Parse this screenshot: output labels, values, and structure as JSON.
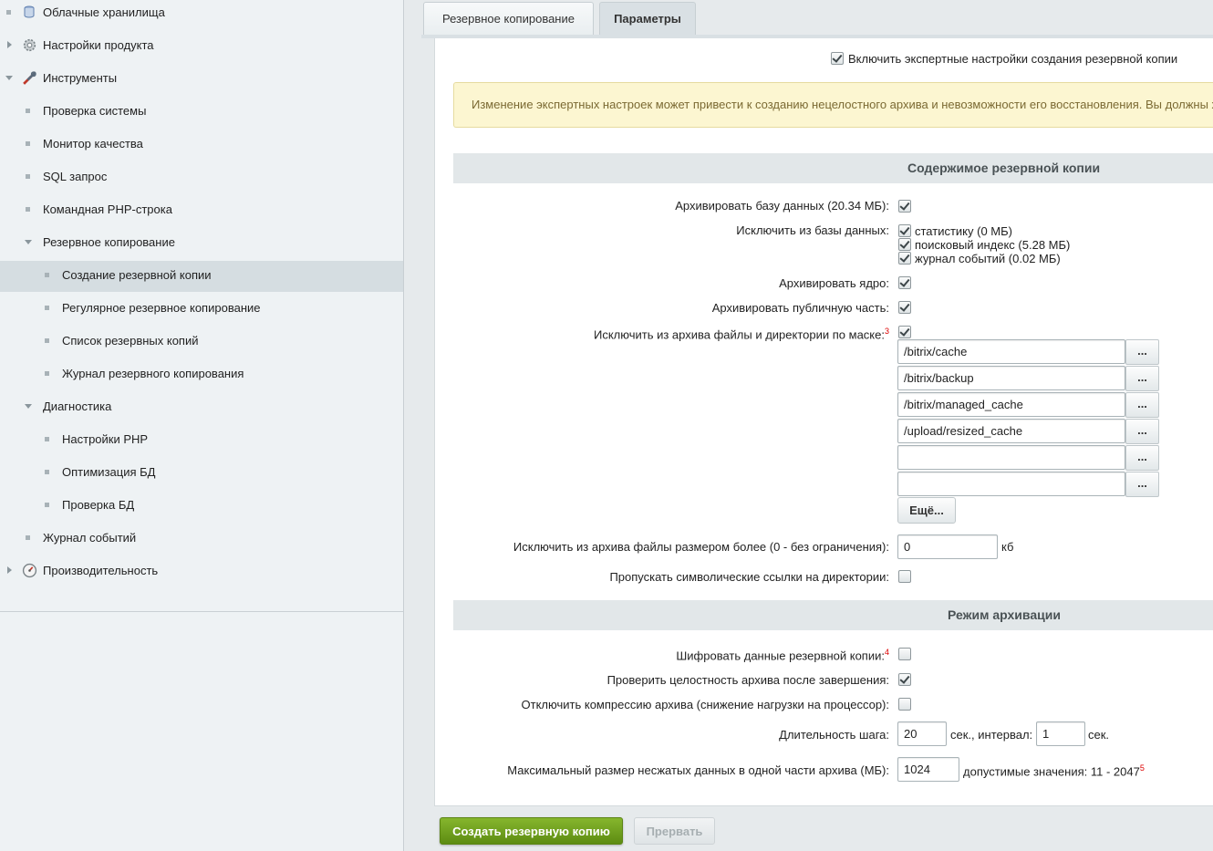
{
  "sidebar": {
    "items": [
      {
        "label": "Облачные хранилища"
      },
      {
        "label": "Настройки продукта"
      },
      {
        "label": "Инструменты"
      },
      {
        "label": "Проверка системы"
      },
      {
        "label": "Монитор качества"
      },
      {
        "label": "SQL запрос"
      },
      {
        "label": "Командная PHP-строка"
      },
      {
        "label": "Резервное копирование"
      },
      {
        "label": "Создание резервной копии"
      },
      {
        "label": "Регулярное резервное копирование"
      },
      {
        "label": "Список резервных копий"
      },
      {
        "label": "Журнал резервного копирования"
      },
      {
        "label": "Диагностика"
      },
      {
        "label": "Настройки PHP"
      },
      {
        "label": "Оптимизация БД"
      },
      {
        "label": "Проверка БД"
      },
      {
        "label": "Журнал событий"
      },
      {
        "label": "Производительность"
      }
    ]
  },
  "tabs": [
    {
      "label": "Резервное копирование"
    },
    {
      "label": "Параметры"
    }
  ],
  "expert": {
    "label": "Включить экспертные настройки создания резервной копии",
    "checked": true
  },
  "warning": "Изменение экспертных настроек может привести к созданию нецелостного архива и невозможности его восстановления. Вы должны хорошо понимать, что делаете.",
  "content_section": {
    "title": "Содержимое резервной копии",
    "archive_db": {
      "label": "Архивировать базу данных (20.34 МБ):",
      "checked": true
    },
    "exclude_db": {
      "label": "Исключить из базы данных:",
      "options": [
        {
          "label": "статистику (0 МБ)",
          "checked": true
        },
        {
          "label": "поисковый индекс (5.28 МБ)",
          "checked": true
        },
        {
          "label": "журнал событий (0.02 МБ)",
          "checked": true
        }
      ]
    },
    "archive_core": {
      "label": "Архивировать ядро:",
      "checked": true
    },
    "archive_public": {
      "label": "Архивировать публичную часть:",
      "checked": true
    },
    "exclude_mask": {
      "label": "Исключить из архива файлы и директории по маске:",
      "sup": "3",
      "checked": true,
      "masks": [
        "/bitrix/cache",
        "/bitrix/backup",
        "/bitrix/managed_cache",
        "/upload/resized_cache",
        "",
        ""
      ],
      "dots_label": "...",
      "more_label": "Ещё..."
    },
    "exclude_size": {
      "label": "Исключить из архива файлы размером более (0 - без ограничения):",
      "value": "0",
      "unit": "кб"
    },
    "skip_symlinks": {
      "label": "Пропускать символические ссылки на директории:",
      "checked": false
    }
  },
  "mode_section": {
    "title": "Режим архивации",
    "encrypt": {
      "label": "Шифровать данные резервной копии:",
      "sup": "4",
      "checked": false
    },
    "verify": {
      "label": "Проверить целостность архива после завершения:",
      "checked": true
    },
    "no_compress": {
      "label": "Отключить компрессию архива (снижение нагрузки на процессор):",
      "checked": false
    },
    "step": {
      "label": "Длительность шага:",
      "value": "20",
      "unit1": "сек., интервал:",
      "interval": "1",
      "unit2": "сек."
    },
    "max_size": {
      "label": "Максимальный размер несжатых данных в одной части архива (МБ):",
      "value": "1024",
      "hint": "допустимые значения: 11 - 2047",
      "sup": "5"
    }
  },
  "buttons": {
    "create": "Создать резервную копию",
    "abort": "Прервать"
  }
}
